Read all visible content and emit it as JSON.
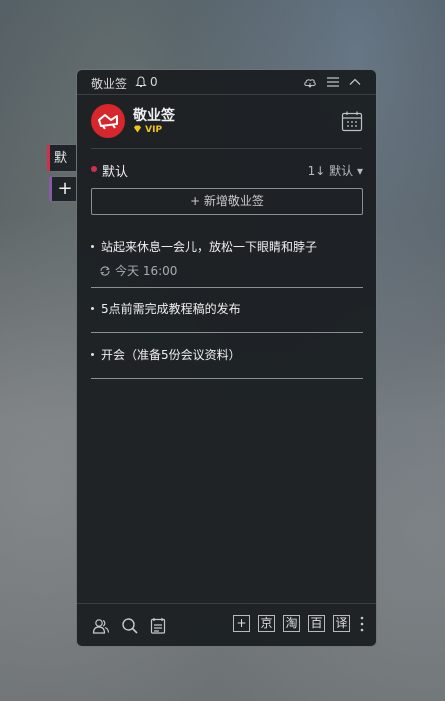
{
  "side": {
    "tab_label": "默认",
    "add_label": "+"
  },
  "titlebar": {
    "app_name": "敬业签",
    "notification_count": "0"
  },
  "profile": {
    "name": "敬业签",
    "badge": "VIP"
  },
  "group": {
    "name": "默认",
    "sort_label": "1↓ 默认 ▾"
  },
  "add_note_label": "+ 新增敬业签",
  "notes": [
    {
      "text": "站起来休息一会儿，放松一下眼睛和脖子",
      "reminder": "今天 16:00"
    },
    {
      "text": "5点前需完成教程稿的发布"
    },
    {
      "text": "开会（准备5份会议资料）"
    }
  ],
  "footer": {
    "tools": [
      "+",
      "京",
      "淘",
      "百",
      "译"
    ]
  },
  "colors": {
    "accent": "#d0314a",
    "avatar": "#d7262c",
    "vip": "#f2c318",
    "panel": "#1c2023"
  }
}
